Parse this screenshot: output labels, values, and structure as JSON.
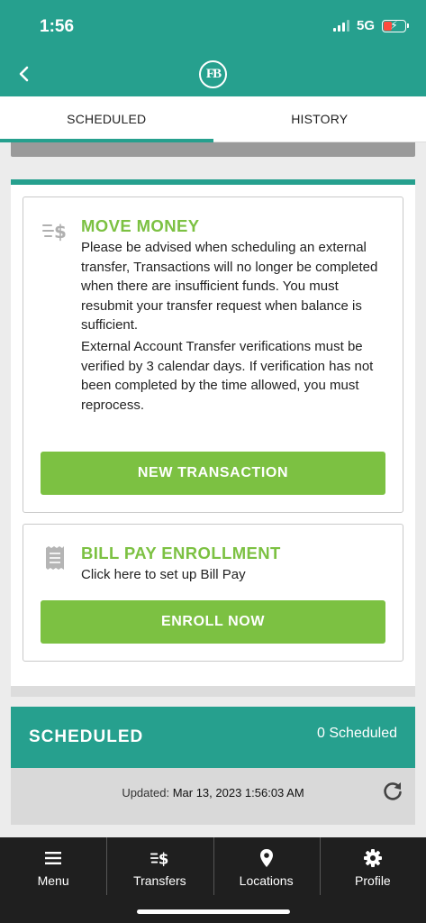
{
  "status_bar": {
    "time": "1:56",
    "network": "5G",
    "battery_icon": "battery-charging-icon"
  },
  "header": {
    "back_icon": "chevron-left-icon",
    "logo_text": "FB"
  },
  "tabs": [
    {
      "label": "SCHEDULED",
      "active": true
    },
    {
      "label": "HISTORY",
      "active": false
    }
  ],
  "move_money": {
    "icon": "transfer-dollar-icon",
    "title": "MOVE MONEY",
    "paragraph1": "Please be advised when scheduling an external transfer, Transactions will no longer be completed when there are insufficient funds. You must resubmit your transfer request when balance is sufficient.",
    "paragraph2": "External Account Transfer verifications must be verified by 3 calendar days. If verification has not been completed by the time allowed, you must reprocess.",
    "button_label": "NEW TRANSACTION"
  },
  "bill_pay": {
    "icon": "receipt-icon",
    "title": "BILL PAY ENROLLMENT",
    "subtitle": "Click here to set up Bill Pay",
    "button_label": "ENROLL NOW"
  },
  "scheduled": {
    "title": "SCHEDULED",
    "count_label": "0 Scheduled",
    "updated_prefix": "Updated:",
    "updated_value": "Mar 13, 2023 1:56:03 AM",
    "refresh_icon": "refresh-icon"
  },
  "bottom_nav": [
    {
      "label": "Menu",
      "icon": "hamburger-menu-icon"
    },
    {
      "label": "Transfers",
      "icon": "transfer-dollar-icon"
    },
    {
      "label": "Locations",
      "icon": "map-pin-icon"
    },
    {
      "label": "Profile",
      "icon": "gear-icon"
    }
  ],
  "colors": {
    "brand_teal": "#26a08e",
    "accent_green": "#7cc142",
    "nav_background": "#1f1f1f"
  }
}
